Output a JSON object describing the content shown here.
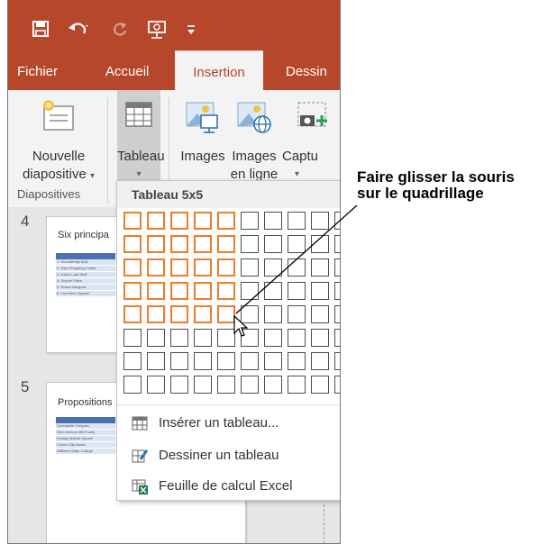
{
  "quick_access": {
    "save_icon": "save-icon",
    "undo_icon": "undo-icon",
    "redo_icon": "redo-icon",
    "present_icon": "start-presentation-icon",
    "customize_icon": "customize-icon"
  },
  "tabs": [
    {
      "label": "Fichier"
    },
    {
      "label": "Accueil"
    },
    {
      "label": "Insertion"
    },
    {
      "label": "Dessin"
    }
  ],
  "ribbon": {
    "new_slide_line1": "Nouvelle",
    "new_slide_line2": "diapositive",
    "table_label": "Tableau",
    "images_label": "Images",
    "online_images_line1": "Images",
    "online_images_line2": "en ligne",
    "capture_label": "Captu",
    "group_label": "Diapositives"
  },
  "slides": [
    {
      "number": "4",
      "title": "Six principa",
      "table_header": "Emplacement",
      "rows": [
        "1. Woodbridge Mall",
        "2. Park Shopping Center",
        "3. Harris Lake Mall",
        "4. Snyder Place",
        "5. Rosen Margues",
        "6. Founder's Square"
      ]
    },
    {
      "number": "5",
      "title": "Propositions",
      "table_header": "Emplacement",
      "rows": [
        "Springdale Cinéplex",
        "Glen Avenue Mill Foods",
        "Findlay Market Square",
        "Center City Arena",
        "Williams State College"
      ]
    }
  ],
  "table_dropdown": {
    "header": "Tableau 5x5",
    "grid_columns": 10,
    "grid_rows": 8,
    "selected_columns": 5,
    "selected_rows": 5,
    "menu": [
      {
        "label": "Insérer un tableau...",
        "icon": "insert-table-icon"
      },
      {
        "label": "Dessiner un tableau",
        "icon": "draw-table-icon"
      },
      {
        "label": "Feuille de calcul Excel",
        "icon": "excel-spreadsheet-icon"
      }
    ]
  },
  "callout": {
    "line1": "Faire glisser la souris",
    "line2": "sur le quadrillage"
  },
  "colors": {
    "accent": "#b7472a",
    "grid_highlight": "#f07b2a"
  }
}
